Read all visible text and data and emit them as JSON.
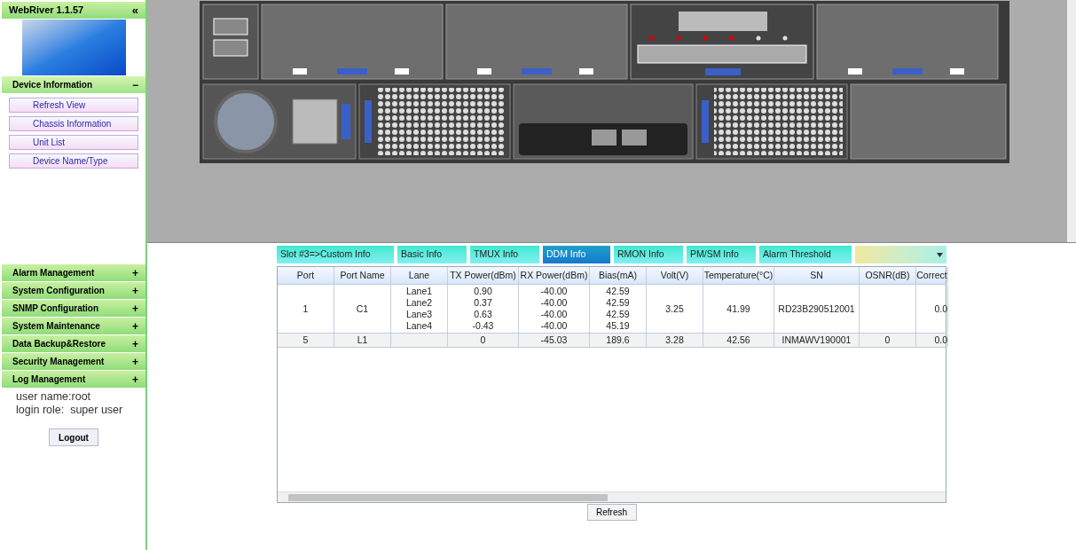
{
  "sidebar": {
    "title": "WebRiver 1.1.57",
    "collapse": "«",
    "sections": [
      {
        "title": "Device Information",
        "toggle": "−",
        "expanded": true,
        "items": [
          "Refresh View",
          "Chassis Information",
          "Unit List",
          "Device Name/Type"
        ]
      },
      {
        "title": "Alarm Management",
        "toggle": "+",
        "expanded": false
      },
      {
        "title": "System Configuration",
        "toggle": "+",
        "expanded": false
      },
      {
        "title": "SNMP Configuration",
        "toggle": "+",
        "expanded": false
      },
      {
        "title": "System Maintenance",
        "toggle": "+",
        "expanded": false
      },
      {
        "title": "Data Backup&Restore",
        "toggle": "+",
        "expanded": false
      },
      {
        "title": "Security Management",
        "toggle": "+",
        "expanded": false
      },
      {
        "title": "Log Management",
        "toggle": "+",
        "expanded": false
      }
    ],
    "user_info": [
      "user name:root",
      "login role:  super user"
    ],
    "logout": "Logout"
  },
  "tabs": [
    {
      "label": "Slot #3=>Custom Info",
      "selected": false
    },
    {
      "label": "Basic Info",
      "selected": false
    },
    {
      "label": "TMUX Info",
      "selected": false
    },
    {
      "label": "DDM Info",
      "selected": true
    },
    {
      "label": "RMON Info",
      "selected": false
    },
    {
      "label": "PM/SM Info",
      "selected": false
    },
    {
      "label": "Alarm Threshold",
      "selected": false
    }
  ],
  "table": {
    "columns": [
      "Port",
      "Port Name",
      "Lane",
      "TX Power(dBm)",
      "RX Power(dBm)",
      "Bias(mA)",
      "Volt(V)",
      "Temperature(°C)",
      "SN",
      "OSNR(dB)",
      "Correct"
    ],
    "rows": [
      [
        [
          "1"
        ],
        [
          "C1"
        ],
        [
          "Lane1",
          "Lane2",
          "Lane3",
          "Lane4"
        ],
        [
          "0.90",
          "0.37",
          "0.63",
          "-0.43"
        ],
        [
          "-40.00",
          "-40.00",
          "-40.00",
          "-40.00"
        ],
        [
          "42.59",
          "42.59",
          "42.59",
          "45.19"
        ],
        [
          "3.25"
        ],
        [
          "41.99"
        ],
        [
          "RD23B290512001"
        ],
        [],
        [
          "0.0"
        ]
      ],
      [
        [
          "5"
        ],
        [
          "L1"
        ],
        [],
        [
          "0"
        ],
        [
          "-45.03"
        ],
        [
          "189.6"
        ],
        [
          "3.28"
        ],
        [
          "42.56"
        ],
        [
          "INMAWV190001"
        ],
        [
          "0"
        ],
        [
          "0.0"
        ]
      ]
    ]
  },
  "refresh": "Refresh"
}
